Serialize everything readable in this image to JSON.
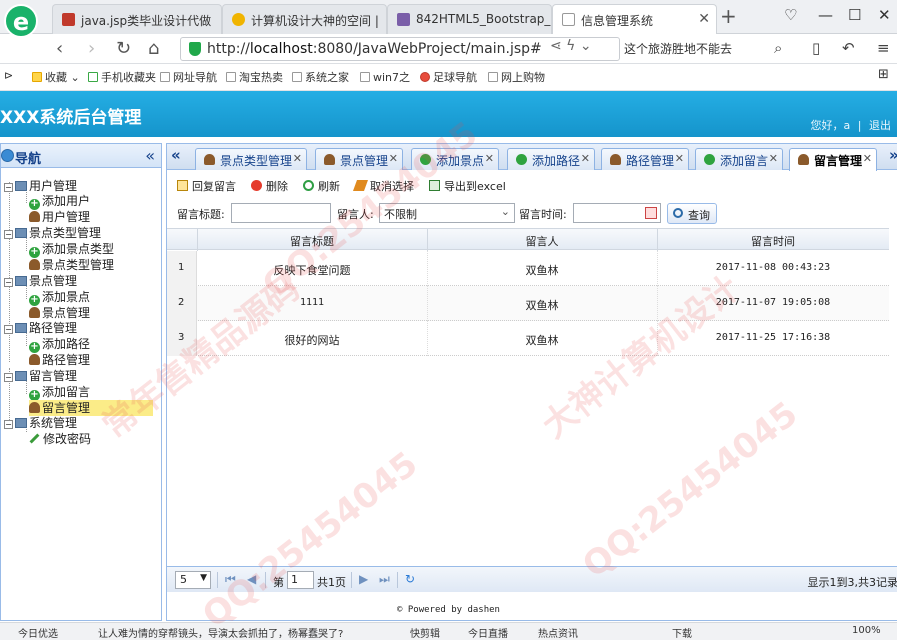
{
  "browser": {
    "logo": "e",
    "tabs": [
      {
        "title": "java.jsp类毕业设计代做"
      },
      {
        "title": "计算机设计大神的空间 |"
      },
      {
        "title": "842HTML5_Bootstrap_"
      },
      {
        "title": "信息管理系统"
      }
    ],
    "url_prefix": "http://",
    "url_host": "localhost",
    "url_rest": ":8080/JavaWebProject/main.jsp#",
    "search_hint": "这个旅游胜地不能去",
    "bookmarks": [
      "收藏",
      "手机收藏夹",
      "网址导航",
      "淘宝热卖",
      "系统之家",
      "win7之",
      "足球导航",
      "网上购物"
    ]
  },
  "app": {
    "title": "XXX系统后台管理",
    "greeting": "您好，a",
    "logout": "退出"
  },
  "sidebar": {
    "title": "导航",
    "collapse": "«",
    "groups": [
      {
        "label": "用户管理",
        "items": [
          "添加用户",
          "用户管理"
        ]
      },
      {
        "label": "景点类型管理",
        "items": [
          "添加景点类型",
          "景点类型管理"
        ]
      },
      {
        "label": "景点管理",
        "items": [
          "添加景点",
          "景点管理"
        ]
      },
      {
        "label": "路径管理",
        "items": [
          "添加路径",
          "路径管理"
        ]
      },
      {
        "label": "留言管理",
        "items": [
          "添加留言",
          "留言管理"
        ]
      },
      {
        "label": "系统管理",
        "items": [
          "修改密码"
        ]
      }
    ]
  },
  "tabs": [
    "景点类型管理",
    "景点管理",
    "添加景点",
    "添加路径",
    "路径管理",
    "添加留言",
    "留言管理"
  ],
  "toolbar": {
    "reply": "回复留言",
    "delete": "删除",
    "refresh": "刷新",
    "unselect": "取消选择",
    "export": "导出到excel"
  },
  "search": {
    "title_label": "留言标题:",
    "user_label": "留言人:",
    "user_value": "不限制",
    "time_label": "留言时间:",
    "query": "查询"
  },
  "grid": {
    "columns": [
      "留言标题",
      "留言人",
      "留言时间"
    ],
    "rows": [
      {
        "n": "1",
        "title": "反映下食堂问题",
        "user": "双鱼林",
        "time": "2017-11-08 00:43:23"
      },
      {
        "n": "2",
        "title": "1111",
        "user": "双鱼林",
        "time": "2017-11-07 19:05:08"
      },
      {
        "n": "3",
        "title": "很好的网站",
        "user": "双鱼林",
        "time": "2017-11-25 17:16:38"
      }
    ]
  },
  "pager": {
    "page_size": "5",
    "page_pre": "第",
    "page_value": "1",
    "page_post": "共1页",
    "info": "显示1到3,共3记录"
  },
  "footer": "© Powered by dashen",
  "statusbar": [
    "今日优选",
    "让人难为情的穿帮镜头，导演太会抓拍了，杨幂蠢哭了?",
    "快剪辑",
    "今日直播",
    "热点资讯",
    "下载",
    "100%"
  ],
  "watermark": [
    "QQ:25454045",
    "常年售精品源码",
    "大神计算机设计"
  ]
}
